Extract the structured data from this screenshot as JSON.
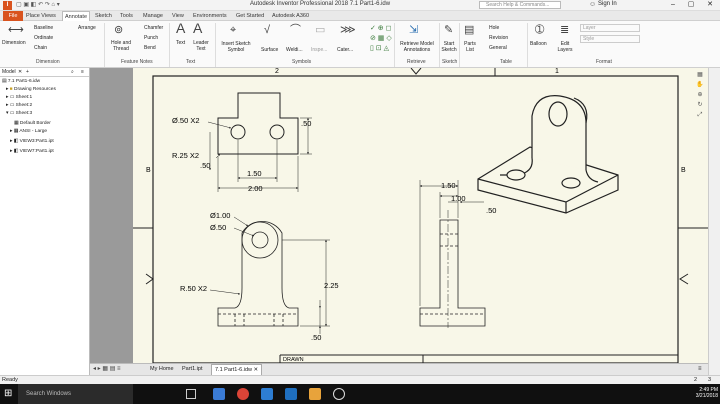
{
  "window": {
    "title": "Autodesk Inventor Professional 2018    7.1 Part1-6.idw",
    "search_placeholder": "Search Help & Commands...",
    "sign_in": "Sign In"
  },
  "ribbon_tabs": [
    "File",
    "Place Views",
    "Annotate",
    "Sketch",
    "Tools",
    "Manage",
    "View",
    "Environments",
    "Get Started",
    "Autodesk A360"
  ],
  "ribbon": {
    "dimension": "Dimension",
    "baseline": "Baseline",
    "ordinate": "Ordinate",
    "chain": "Chain",
    "arrange": "Arrange",
    "hole_thread": "Hole and Thread",
    "chamfer": "Chamfer",
    "punch": "Punch",
    "bend": "Bend",
    "text": "Text",
    "leader_text": "Leader Text",
    "insert_sketch_symbol": "Insert Sketch Symbol",
    "surface": "Surface",
    "welding": "Weldi...",
    "inspection": "Inspe...",
    "caterpillar": "Cater...",
    "retrieve": "Retrieve Model Annotations",
    "start_sketch": "Start Sketch",
    "parts_list": "Parts List",
    "hole": "Hole",
    "revision": "Revision",
    "general": "General",
    "balloon": "Balloon",
    "edit_layers": "Edit Layers",
    "layer": "Layer",
    "style": "Style",
    "panels": [
      "Dimension",
      "Feature Notes",
      "Text",
      "Symbols",
      "Retrieve",
      "Sketch",
      "Table",
      "Format"
    ]
  },
  "browser": {
    "tab": "Model",
    "items": [
      "7.1 Part1-6.idw",
      "Drawing Resources",
      "Sheet:1",
      "Sheet:2",
      "Sheet:3",
      "Default Border",
      "ANSI - Large",
      "VIEW3:Part1.ipt",
      "VIEW7:Part1.ipt"
    ]
  },
  "drawing": {
    "zone_top": [
      "2",
      "1"
    ],
    "zone_side": [
      "B",
      "B"
    ],
    "dim_hole_top": "Ø.50 X2",
    "dim_r25": "R.25 X2",
    "dim_50_a": ".50",
    "dim_50_b": ".50",
    "dim_150_a": "1.50",
    "dim_200": "2.00",
    "dim_d100": "Ø1.00",
    "dim_d50": "Ø.50",
    "dim_r50": "R.50 X2",
    "dim_225": "2.25",
    "dim_50_c": ".50",
    "dim_150_b": "1.50",
    "dim_100": "1.00",
    "dim_50_d": ".50",
    "title_block": "DRAWN"
  },
  "doc_tabs": [
    "My Home",
    "Part1.ipt",
    "7.1 Part1-6.idw"
  ],
  "status": {
    "text": "Ready",
    "n1": "2",
    "n2": "3"
  },
  "taskbar": {
    "search": "Search Windows",
    "time": "2:49 PM",
    "date": "3/21/2018"
  }
}
